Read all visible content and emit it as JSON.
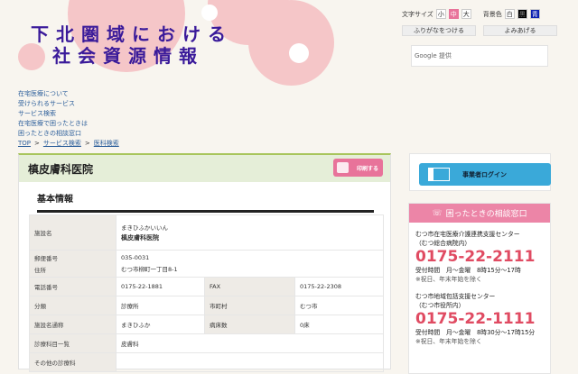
{
  "header": {
    "title_line1": "下北圏域における",
    "title_line2": "社会資源情報"
  },
  "nav": {
    "links": [
      "在宅医療について",
      "受けられるサービス",
      "サービス検索",
      "在宅医療で困ったときは",
      "困ったときの相談窓口"
    ],
    "breadcrumb": [
      "TOP",
      "サービス検索",
      "医科検索"
    ],
    "separator": ">"
  },
  "controls": {
    "font_size_label": "文字サイズ",
    "sizes": [
      "小",
      "中",
      "大"
    ],
    "bg_label": "背景色",
    "bgs": [
      "白",
      "黒",
      "青"
    ],
    "furigana": "ふりがなをつける",
    "read_aloud": "よみあげる",
    "search_placeholder": "Google 提供"
  },
  "main": {
    "facility_title": "槙皮膚科医院",
    "print_label": "印刷する",
    "section": "基本情報",
    "rows": [
      {
        "label": "施設名",
        "kana": "まきひふかいいん",
        "value": "槙皮膚科医院"
      },
      {
        "label": "郵便番号",
        "label2": "住所",
        "value": "035-0031",
        "value2": "むつ市柳町一丁目8-1"
      },
      {
        "label": "電話番号",
        "value": "0175-22-1881",
        "label_b": "FAX",
        "value_b": "0175-22-2308"
      },
      {
        "label": "分類",
        "value": "診療所",
        "label_b": "市町村",
        "value_b": "むつ市"
      },
      {
        "label": "施設名通称",
        "value": "まきひふか",
        "label_b": "病床数",
        "value_b": "0床"
      },
      {
        "label": "診療科目一覧",
        "value": "皮膚科"
      },
      {
        "label": "その他の診療科",
        "value": ""
      }
    ]
  },
  "sidebar": {
    "login": "事業者ログイン",
    "consult_title": "困ったときの相談窓口",
    "centers": [
      {
        "name": "むつ市在宅医療介護連携支援センター",
        "sub": "（むつ総合病院内）",
        "tel": "0175-22-2111",
        "hours": "受付時間　月～金曜　8時15分～17時",
        "note": "※祝日、年末年始を除く"
      },
      {
        "name": "むつ市地域包括支援センター",
        "sub": "（むつ市役所内）",
        "tel": "0175-22-1111",
        "hours": "受付時間　月～金曜　8時30分～17時15分",
        "note": "※祝日、年末年始を除く"
      }
    ]
  },
  "colors": {
    "accent_pink": "#ec85a7",
    "title_purple": "#3a1a9a",
    "tel_red": "#e04b62",
    "login_blue": "#3aa9d9"
  }
}
